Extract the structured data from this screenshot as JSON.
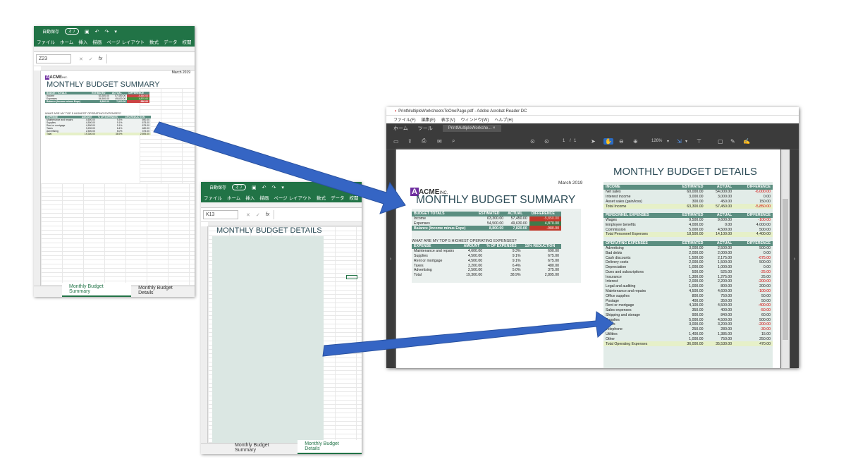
{
  "excel1": {
    "autosave": "自動保存",
    "toggle": "オフ",
    "menu": [
      "ファイル",
      "ホーム",
      "挿入",
      "描画",
      "ページ レイアウト",
      "数式",
      "データ",
      "校閲"
    ],
    "namebox": "Z23",
    "fx_icon": "fx",
    "date": "March 2019",
    "company": "ACME",
    "company_suffix": "INC.",
    "title": "MONTHLY BUDGET SUMMARY",
    "totals_headers": [
      "BUDGET TOTALS",
      "ESTIMATED",
      "ACTUAL",
      "DIFFERENCE"
    ],
    "totals_rows": [
      [
        "Income",
        "63,300.00",
        "57,450.00",
        "-5,850.00"
      ],
      [
        "Expenses",
        "54,500.00",
        "49,630.00",
        "4,870.00"
      ],
      [
        "Balance (Income minus Expe)",
        "8,800.00",
        "7,820.00",
        "-980.00"
      ]
    ],
    "top5_heading": "WHAT ARE MY TOP 5 HIGHEST OPERATING EXPENSES?",
    "top5_headers": [
      "EXPENSE",
      "AMOUNT",
      "% OF EXPENSES",
      "15% REDUCTION"
    ],
    "top5_rows": [
      [
        "Maintenance and repairs",
        "4,600.00",
        "9.3%",
        "690.00"
      ],
      [
        "Supplies",
        "4,500.00",
        "9.1%",
        "675.00"
      ],
      [
        "Rent or mortgage",
        "4,500.00",
        "9.1%",
        "675.00"
      ],
      [
        "Taxes",
        "3,200.00",
        "6.4%",
        "480.00"
      ],
      [
        "Advertising",
        "2,500.00",
        "5.0%",
        "375.00"
      ],
      [
        "Total",
        "19,300.00",
        "38.9%",
        "2,895.00"
      ]
    ],
    "tabs": [
      "Monthly Budget Summary",
      "Monthly Budget Details"
    ]
  },
  "excel2": {
    "autosave": "自動保存",
    "toggle": "オフ",
    "menu": [
      "ファイル",
      "ホーム",
      "挿入",
      "描画",
      "ページ レイアウト",
      "数式",
      "データ",
      "校閲"
    ],
    "namebox": "K13",
    "fx_icon": "fx",
    "title": "MONTHLY BUDGET DETAILS",
    "tabs": [
      "Monthly Budget Summary",
      "Monthly Budget Details"
    ]
  },
  "acrobat": {
    "title": "PrintMultipleWorksheetsToOnePage.pdf - Adobe Acrobat Reader DC",
    "menu": [
      "ファイル(F)",
      "編集(E)",
      "表示(V)",
      "ウィンドウ(W)",
      "ヘルプ(H)"
    ],
    "tabs": [
      "ホーム",
      "ツール",
      "PrintMultipleWorkshe..."
    ],
    "tab_close": "×",
    "page_num": "1",
    "page_sep": "/",
    "page_total": "1",
    "zoom": "126%"
  },
  "summary": {
    "date": "March 2019",
    "company": "ACME",
    "company_suffix": "INC.",
    "title": "MONTHLY BUDGET SUMMARY",
    "totals_headers": [
      "BUDGET TOTALS",
      "ESTIMATED",
      "ACTUAL",
      "DIFFERENCE"
    ],
    "totals_rows": [
      [
        "Income",
        "63,300.00",
        "57,450.00",
        "-5,850.00"
      ],
      [
        "Expenses",
        "54,500.00",
        "49,630.00",
        "4,870.00"
      ],
      [
        "Balance (Income minus Expe)",
        "8,800.00",
        "7,820.00",
        "-980.00"
      ]
    ],
    "top5_heading": "WHAT ARE MY TOP 5 HIGHEST OPERATING EXPENSES?",
    "top5_headers": [
      "EXPENSE",
      "AMOUNT",
      "% OF EXPENSES",
      "15% REDUCTION"
    ],
    "top5_rows": [
      [
        "Maintenance and repairs",
        "4,600.00",
        "9.3%",
        "690.00"
      ],
      [
        "Supplies",
        "4,500.00",
        "9.1%",
        "675.00"
      ],
      [
        "Rent or mortgage",
        "4,500.00",
        "9.1%",
        "675.00"
      ],
      [
        "Taxes",
        "3,200.00",
        "6.4%",
        "480.00"
      ],
      [
        "Advertising",
        "2,500.00",
        "5.0%",
        "375.00"
      ],
      [
        "Total",
        "19,300.00",
        "38.9%",
        "2,895.00"
      ]
    ]
  },
  "details": {
    "title": "MONTHLY BUDGET DETAILS",
    "sections": [
      {
        "headers": [
          "INCOME",
          "ESTIMATED",
          "ACTUAL",
          "DIFFERENCE"
        ],
        "rows": [
          [
            "Net sales",
            "60,000.00",
            "54,000.00",
            "-6,000.00"
          ],
          [
            "Interest income",
            "3,000.00",
            "3,000.00",
            "0.00"
          ],
          [
            "Asset sales (gain/loss)",
            "300.00",
            "450.00",
            "150.00"
          ]
        ],
        "total": [
          "Total Income",
          "63,300.00",
          "57,450.00",
          "-5,850.00"
        ]
      },
      {
        "headers": [
          "PERSONNEL EXPENSES",
          "ESTIMATED",
          "ACTUAL",
          "DIFFERENCE"
        ],
        "rows": [
          [
            "Wages",
            "9,500.00",
            "9,600.00",
            "-100.00"
          ],
          [
            "Employee benefits",
            "4,000.00",
            "0.00",
            "4,000.00"
          ],
          [
            "Commission",
            "5,000.00",
            "4,500.00",
            "500.00"
          ]
        ],
        "total": [
          "Total Personnel Expenses",
          "18,500.00",
          "14,100.00",
          "4,400.00"
        ]
      },
      {
        "headers": [
          "OPERATING EXPENSES",
          "ESTIMATED",
          "ACTUAL",
          "DIFFERENCE"
        ],
        "rows": [
          [
            "Advertising",
            "3,000.00",
            "2,500.00",
            "500.00"
          ],
          [
            "Bad debts",
            "2,000.00",
            "2,000.00",
            "0.00"
          ],
          [
            "Cash discounts",
            "1,500.00",
            "2,175.00",
            "-675.00"
          ],
          [
            "Delivery costs",
            "2,000.00",
            "1,500.00",
            "500.00"
          ],
          [
            "Depreciation",
            "1,000.00",
            "1,000.00",
            "0.00"
          ],
          [
            "Dues and subscriptions",
            "500.00",
            "525.00",
            "-25.00"
          ],
          [
            "Insurance",
            "1,300.00",
            "1,275.00",
            "25.00"
          ],
          [
            "Interest",
            "2,000.00",
            "2,200.00",
            "-200.00"
          ],
          [
            "Legal and auditing",
            "1,000.00",
            "800.00",
            "200.00"
          ],
          [
            "Maintenance and repairs",
            "4,500.00",
            "4,600.00",
            "-100.00"
          ],
          [
            "Office supplies",
            "800.00",
            "750.00",
            "50.00"
          ],
          [
            "Postage",
            "400.00",
            "350.00",
            "50.00"
          ],
          [
            "Rent or mortgage",
            "4,100.00",
            "4,500.00",
            "-400.00"
          ],
          [
            "Sales expenses",
            "350.00",
            "400.00",
            "-50.00"
          ],
          [
            "Shipping and storage",
            "900.00",
            "840.00",
            "60.00"
          ],
          [
            "Supplies",
            "5,000.00",
            "4,500.00",
            "500.00"
          ],
          [
            "Taxes",
            "3,000.00",
            "3,200.00",
            "-200.00"
          ],
          [
            "Telephone",
            "250.00",
            "280.00",
            "-30.00"
          ],
          [
            "Utilities",
            "1,400.00",
            "1,385.00",
            "15.00"
          ],
          [
            "Other",
            "1,000.00",
            "750.00",
            "250.00"
          ]
        ],
        "total": [
          "Total Operating Expenses",
          "36,000.00",
          "35,530.00",
          "470.00"
        ]
      }
    ]
  },
  "colors": {
    "excel_green": "#217346",
    "table_header": "#5b8e80",
    "title_text": "#2d4c57",
    "arrow": "#3565c4",
    "negative": "#d00000",
    "acrobat_dark": "#3b3b3b"
  }
}
